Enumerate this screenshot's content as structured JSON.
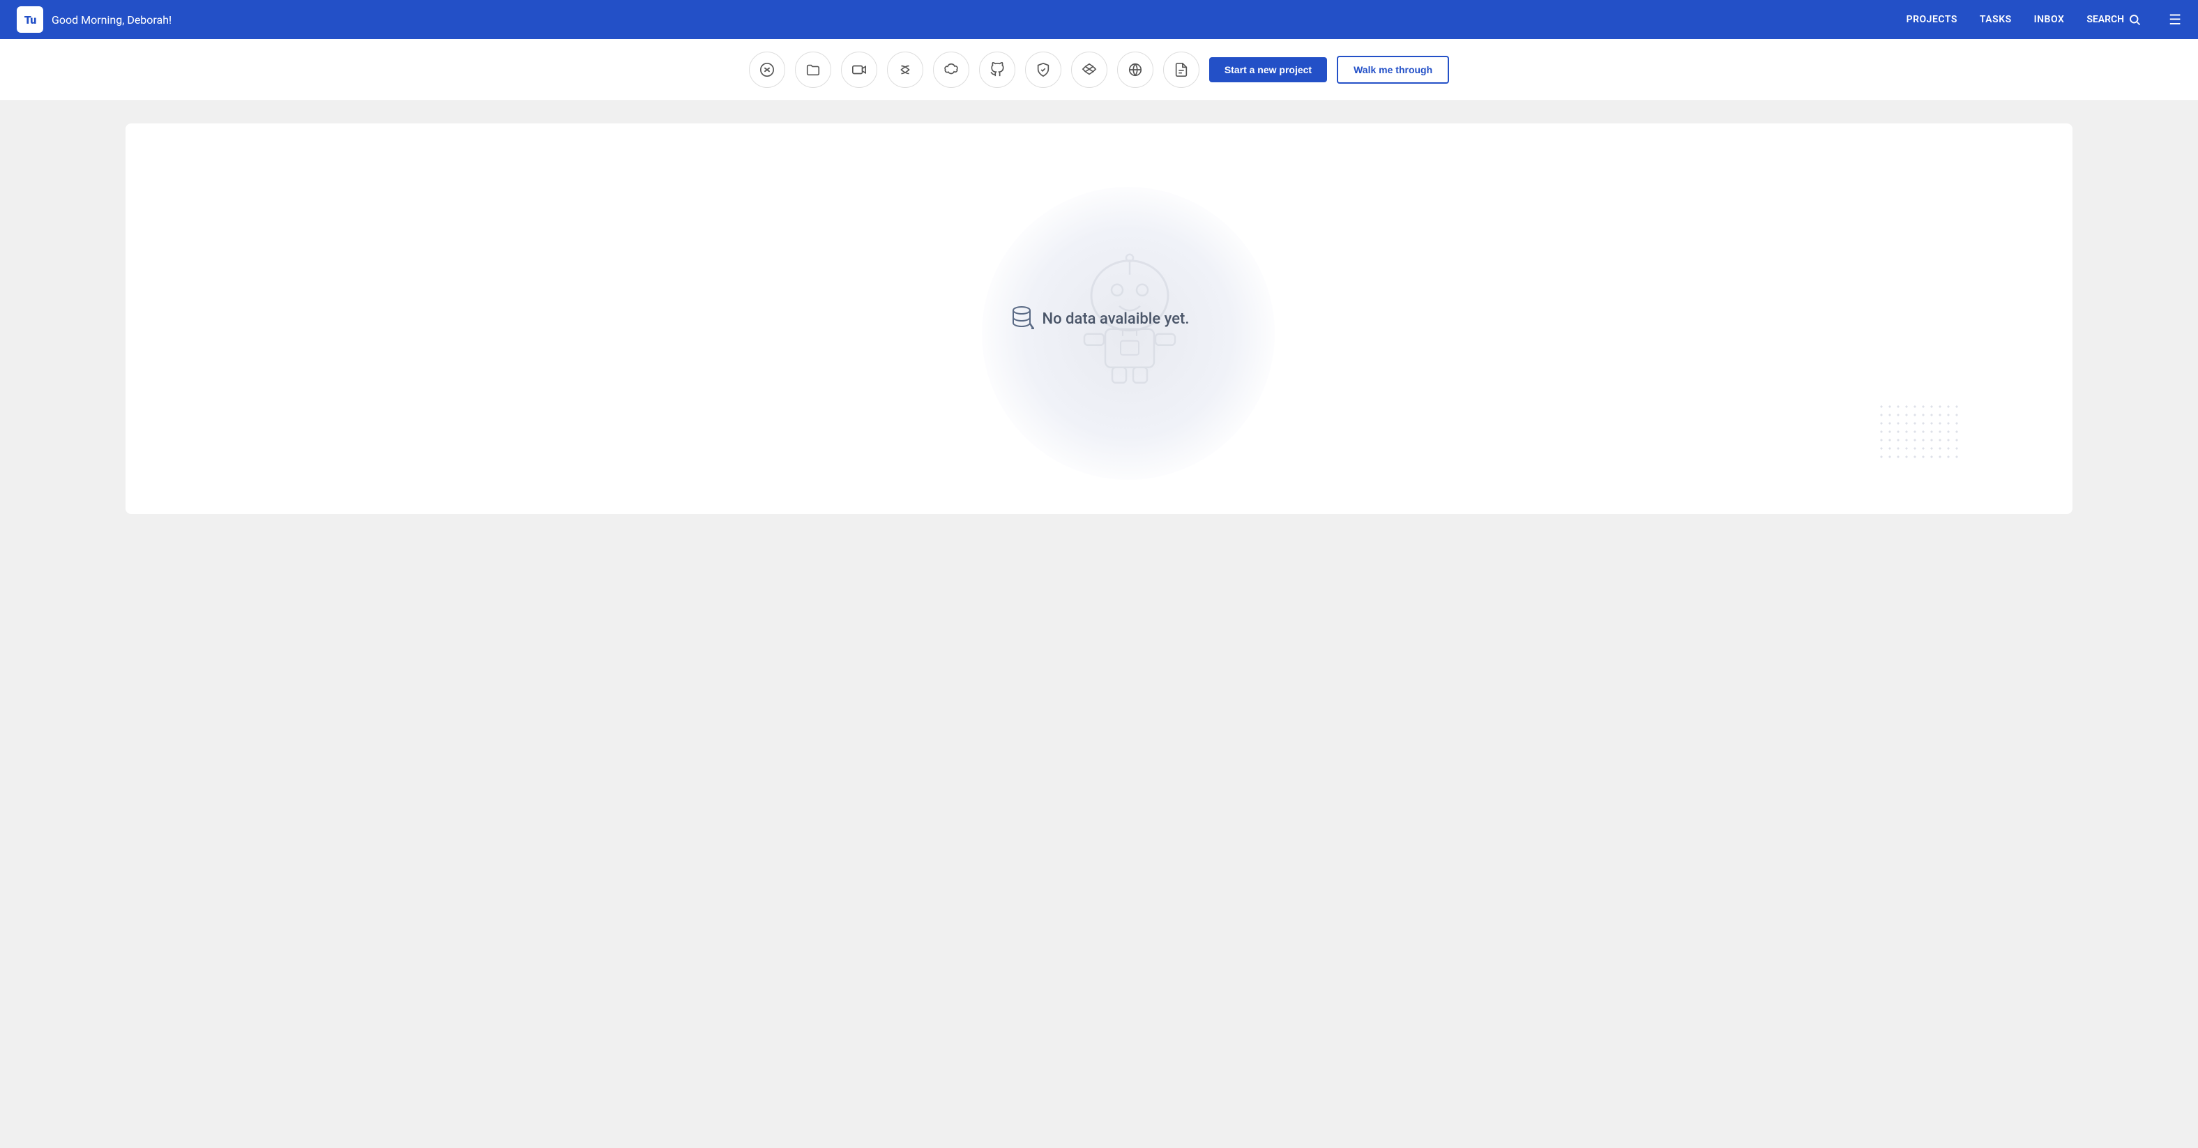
{
  "brand": {
    "logo_text": "Tu",
    "greeting": "Good Morning, Deborah!"
  },
  "navbar": {
    "items": [
      {
        "label": "PROJECTS",
        "active": true
      },
      {
        "label": "TASKS",
        "active": false
      },
      {
        "label": "INBOX",
        "active": false
      }
    ],
    "search_label": "SEARCH",
    "menu_icon": "☰"
  },
  "toolbar": {
    "tools": [
      {
        "id": "zendesk",
        "symbol": "✦",
        "title": "Zendesk"
      },
      {
        "id": "folder",
        "symbol": "📁",
        "title": "Folder"
      },
      {
        "id": "video",
        "symbol": "📹",
        "title": "Video"
      },
      {
        "id": "cut",
        "symbol": "✂",
        "title": "Cut/Confluence"
      },
      {
        "id": "salesforce",
        "symbol": "☁",
        "title": "Salesforce"
      },
      {
        "id": "github",
        "symbol": "⊙",
        "title": "GitHub"
      },
      {
        "id": "shield",
        "symbol": "🛡",
        "title": "Shield"
      },
      {
        "id": "dropbox",
        "symbol": "◇",
        "title": "Dropbox"
      },
      {
        "id": "globe",
        "symbol": "🌐",
        "title": "Globe"
      },
      {
        "id": "doc",
        "symbol": "📄",
        "title": "Document"
      }
    ],
    "start_new_project_label": "Start a new project",
    "walk_me_through_label": "Walk me through"
  },
  "main": {
    "empty_state_text": "No data avalaible yet."
  },
  "colors": {
    "primary": "#2350c7",
    "empty_text": "#4a5568"
  }
}
